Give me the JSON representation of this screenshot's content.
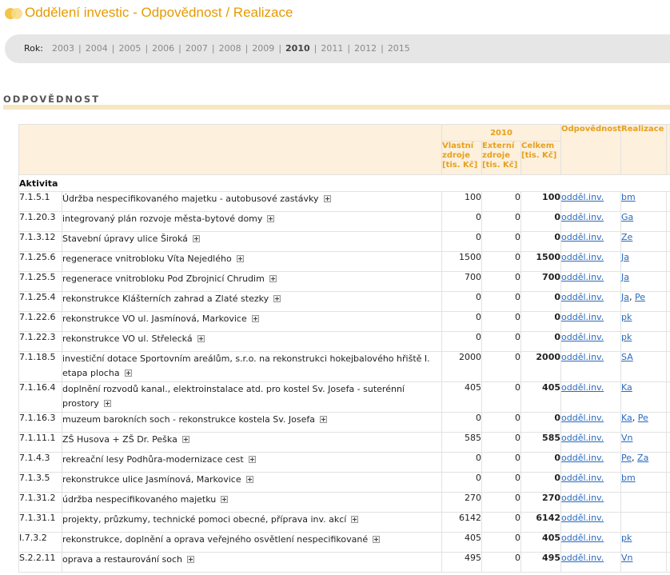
{
  "header": {
    "title": "Oddělení investic - Odpovědnost / Realizace"
  },
  "year_bar": {
    "label": "Rok:",
    "years": [
      {
        "label": "2003",
        "active": false
      },
      {
        "label": "2004",
        "active": false
      },
      {
        "label": "2005",
        "active": false
      },
      {
        "label": "2006",
        "active": false
      },
      {
        "label": "2007",
        "active": false
      },
      {
        "label": "2008",
        "active": false
      },
      {
        "label": "2009",
        "active": false
      },
      {
        "label": "2010",
        "active": true
      },
      {
        "label": "2011",
        "active": false
      },
      {
        "label": "2012",
        "active": false
      },
      {
        "label": "2015",
        "active": false
      }
    ]
  },
  "section": {
    "title": "ODPOVĚDNOST"
  },
  "table": {
    "year_header": "2010",
    "columns": {
      "vlastni": "Vlastní zdroje [tis. Kč]",
      "externi": "Externí zdroje [tis. Kč]",
      "celkem": "Celkem [tis. Kč]",
      "odpovednost": "Odpovědnost",
      "realizace": "Realizace"
    },
    "group_label": "Aktivita",
    "rows": [
      {
        "code": "7.1.5.1",
        "activity": "Údržba nespecifikovaného majetku - autobusové zastávky",
        "vlastni": "100",
        "externi": "0",
        "celkem": "100",
        "odp": "odděl.inv.",
        "real": [
          "bm"
        ]
      },
      {
        "code": "7.1.20.3",
        "activity": "integrovaný plán rozvoje města-bytové domy",
        "vlastni": "0",
        "externi": "0",
        "celkem": "0",
        "odp": "odděl.inv.",
        "real": [
          "Ga"
        ]
      },
      {
        "code": "7.1.3.12",
        "activity": "Stavební úpravy ulice Široká",
        "vlastni": "0",
        "externi": "0",
        "celkem": "0",
        "odp": "odděl.inv.",
        "real": [
          "Ze"
        ]
      },
      {
        "code": "7.1.25.6",
        "activity": "regenerace vnitrobloku Víta Nejedlého",
        "vlastni": "1500",
        "externi": "0",
        "celkem": "1500",
        "odp": "odděl.inv.",
        "real": [
          "Ja"
        ]
      },
      {
        "code": "7.1.25.5",
        "activity": "regenerace vnitrobloku Pod Zbrojnicí Chrudim",
        "vlastni": "700",
        "externi": "0",
        "celkem": "700",
        "odp": "odděl.inv.",
        "real": [
          "Ja"
        ]
      },
      {
        "code": "7.1.25.4",
        "activity": "rekonstrukce Klášterních zahrad a Zlaté stezky",
        "vlastni": "0",
        "externi": "0",
        "celkem": "0",
        "odp": "odděl.inv.",
        "real": [
          "Ja",
          "Pe"
        ]
      },
      {
        "code": "7.1.22.6",
        "activity": "rekonstrukce VO ul. Jasmínová, Markovice",
        "vlastni": "0",
        "externi": "0",
        "celkem": "0",
        "odp": "odděl.inv.",
        "real": [
          "pk"
        ]
      },
      {
        "code": "7.1.22.3",
        "activity": "rekonstrukce VO ul. Střelecká",
        "vlastni": "0",
        "externi": "0",
        "celkem": "0",
        "odp": "odděl.inv.",
        "real": [
          "pk"
        ]
      },
      {
        "code": "7.1.18.5",
        "activity": "investiční dotace Sportovním areálům, s.r.o. na rekonstrukci hokejbalového hřiště I. etapa plocha",
        "vlastni": "2000",
        "externi": "0",
        "celkem": "2000",
        "odp": "odděl.inv.",
        "real": [
          "SA"
        ]
      },
      {
        "code": "7.1.16.4",
        "activity": "doplnění rozvodů kanal., elektroinstalace atd. pro kostel Sv. Josefa - suterénní prostory",
        "vlastni": "405",
        "externi": "0",
        "celkem": "405",
        "odp": "odděl.inv.",
        "real": [
          "Ka"
        ]
      },
      {
        "code": "7.1.16.3",
        "activity": "muzeum barokních soch - rekonstrukce kostela Sv. Josefa",
        "vlastni": "0",
        "externi": "0",
        "celkem": "0",
        "odp": "odděl.inv.",
        "real": [
          "Ka",
          "Pe"
        ]
      },
      {
        "code": "7.1.11.1",
        "activity": "ZŠ Husova + ZŠ Dr. Peška",
        "vlastni": "585",
        "externi": "0",
        "celkem": "585",
        "odp": "odděl.inv.",
        "real": [
          "Vn"
        ]
      },
      {
        "code": "7.1.4.3",
        "activity": "rekreační lesy Podhůra-modernizace cest",
        "vlastni": "0",
        "externi": "0",
        "celkem": "0",
        "odp": "odděl.inv.",
        "real": [
          "Pe",
          "Za"
        ]
      },
      {
        "code": "7.1.3.5",
        "activity": "rekonstrukce ulice Jasmínová, Markovice",
        "vlastni": "0",
        "externi": "0",
        "celkem": "0",
        "odp": "odděl.inv.",
        "real": [
          "bm"
        ]
      },
      {
        "code": "7.1.31.2",
        "activity": "údržba nespecifikovaného majetku",
        "vlastni": "270",
        "externi": "0",
        "celkem": "270",
        "odp": "odděl.inv.",
        "real": []
      },
      {
        "code": "7.1.31.1",
        "activity": "projekty, průzkumy, technické pomoci obecné, příprava inv. akcí",
        "vlastni": "6142",
        "externi": "0",
        "celkem": "6142",
        "odp": "odděl.inv.",
        "real": []
      },
      {
        "code": "I.7.3.2",
        "activity": "rekonstrukce, doplnění a oprava veřejného osvětlení nespecifikované",
        "vlastni": "405",
        "externi": "0",
        "celkem": "405",
        "odp": "odděl.inv.",
        "real": [
          "pk"
        ]
      },
      {
        "code": "S.2.2.11",
        "activity": "oprava a restaurování soch",
        "vlastni": "495",
        "externi": "0",
        "celkem": "495",
        "odp": "odděl.inv.",
        "real": [
          "Vn"
        ]
      }
    ]
  }
}
